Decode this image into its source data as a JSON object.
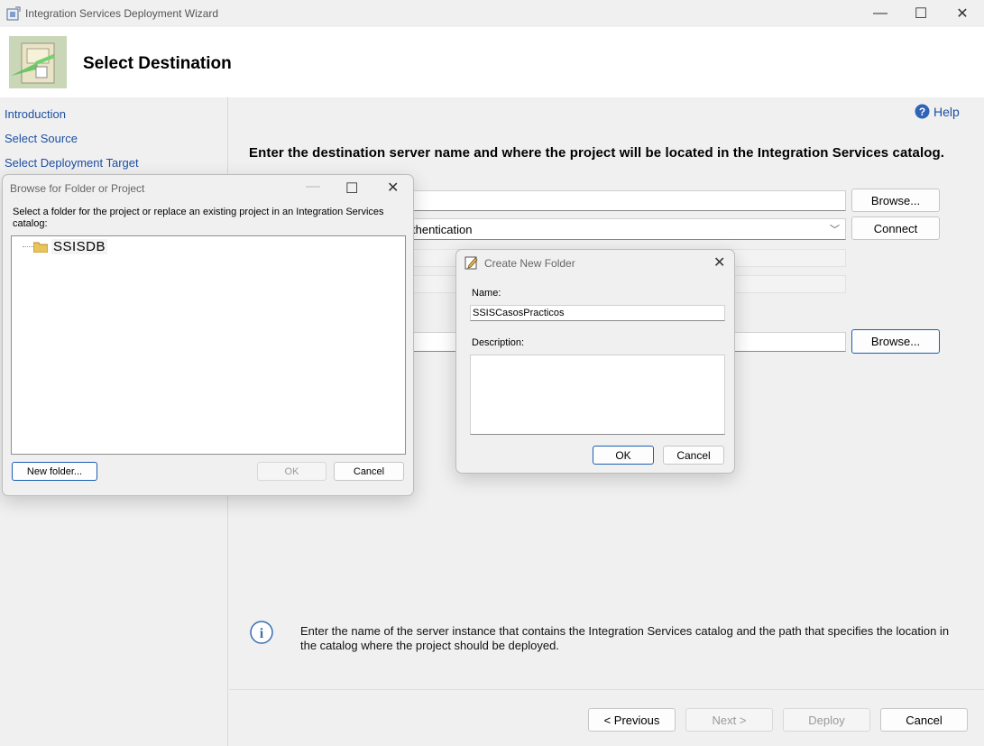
{
  "window": {
    "title": "Integration Services Deployment Wizard",
    "controls": {
      "minimize": "—",
      "maximize": "☐",
      "close": "✕"
    }
  },
  "header": {
    "title": "Select Destination"
  },
  "nav": {
    "items": [
      {
        "label": "Introduction"
      },
      {
        "label": "Select Source"
      },
      {
        "label": "Select Deployment Target"
      }
    ]
  },
  "main": {
    "help_label": "Help",
    "heading": "Enter the destination server name and where the project will be located in the Integration Services catalog.",
    "auth_value_visible": "thentication",
    "browse_server_label": "Browse...",
    "connect_label": "Connect",
    "browse_path_label": "Browse...",
    "info_text": "Enter the name of the server instance that contains the Integration Services catalog and the path that specifies the location in the catalog where the project should be deployed.",
    "previous_label": "< Previous",
    "next_label": "Next >",
    "deploy_label": "Deploy",
    "cancel_label": "Cancel"
  },
  "browse_dialog": {
    "title": "Browse for Folder or Project",
    "instruction": "Select a folder for the project or replace an existing project in an Integration Services catalog:",
    "tree_root": "SSISDB",
    "new_folder_label": "New folder...",
    "ok_label": "OK",
    "cancel_label": "Cancel"
  },
  "create_dialog": {
    "title": "Create New Folder",
    "name_label": "Name:",
    "name_value": "SSISCasosPracticos",
    "description_label": "Description:",
    "description_value": "",
    "ok_label": "OK",
    "cancel_label": "Cancel"
  },
  "colors": {
    "link": "#1c4fa3",
    "accent": "#1a5fb4",
    "info_icon": "#3b6db3"
  }
}
